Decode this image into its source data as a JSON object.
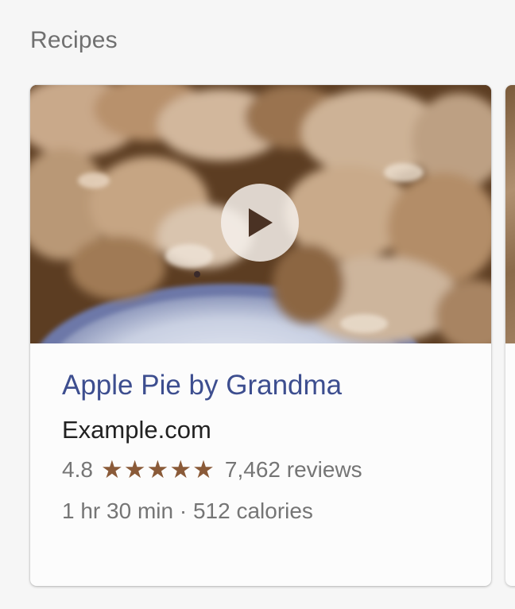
{
  "section": {
    "title": "Recipes"
  },
  "card": {
    "title": "Apple Pie by Grandma",
    "source": "Example.com",
    "rating": "4.8",
    "stars": 5,
    "star_glyph": "★",
    "reviews": "7,462 reviews",
    "meta": "1 hr 30 min · 512 calories",
    "thumbnail_icon": "apple-pie-photo",
    "play_icon": "play-icon"
  },
  "colors": {
    "title_link": "#3d4e8f",
    "star": "#8a5a38",
    "secondary_text": "#757575",
    "background": "#f6f6f6"
  }
}
